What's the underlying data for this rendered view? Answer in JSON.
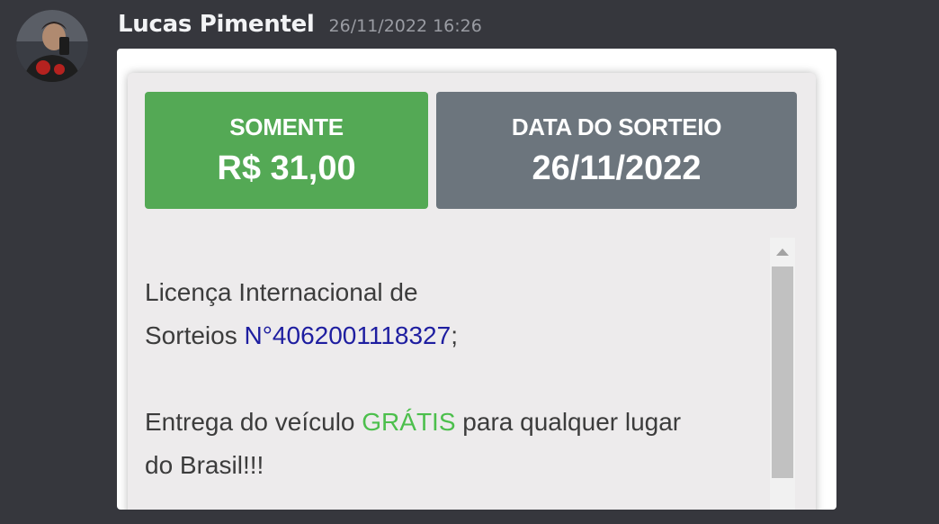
{
  "message": {
    "username": "Lucas Pimentel",
    "timestamp": "26/11/2022 16:26",
    "avatar_icon": "user-avatar-photo"
  },
  "raffle": {
    "price_label": "SOMENTE",
    "price_value": "R$ 31,00",
    "date_label": "DATA DO SORTEIO",
    "date_value": "26/11/2022",
    "license_text_1": "Licença Internacional de",
    "license_text_2": "Sorteios ",
    "license_number": "N°4062001118327",
    "license_end": ";",
    "delivery_text_1": "Entrega do veículo ",
    "delivery_free": "GRÁTIS",
    "delivery_text_2": " para qualquer lugar",
    "delivery_text_3": "do Brasil!!!"
  },
  "colors": {
    "background": "#36373d",
    "price_box": "#54a955",
    "date_box": "#6c757d",
    "license_number": "#1e1ea0",
    "free_word": "#4cbf4c"
  }
}
